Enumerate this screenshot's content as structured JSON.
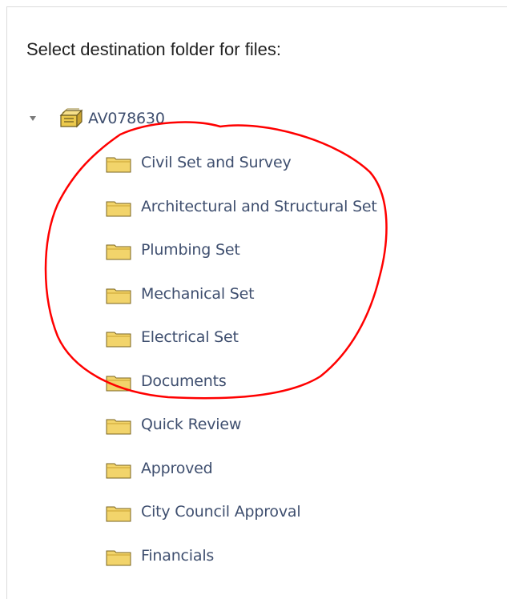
{
  "dialog": {
    "heading": "Select destination folder for files:"
  },
  "tree": {
    "root": {
      "label": "AV078630",
      "icon": "drawer-folder-icon",
      "expanded": true
    },
    "children": [
      {
        "label": "Civil Set and Survey",
        "icon": "folder-icon"
      },
      {
        "label": "Architectural and Structural Set",
        "icon": "folder-icon"
      },
      {
        "label": "Plumbing Set",
        "icon": "folder-icon"
      },
      {
        "label": "Mechanical Set",
        "icon": "folder-icon"
      },
      {
        "label": "Electrical Set",
        "icon": "folder-icon"
      },
      {
        "label": "Documents",
        "icon": "folder-icon"
      },
      {
        "label": "Quick Review",
        "icon": "folder-icon"
      },
      {
        "label": "Approved",
        "icon": "folder-icon"
      },
      {
        "label": "City Council Approval",
        "icon": "folder-icon"
      },
      {
        "label": "Financials",
        "icon": "folder-icon"
      }
    ]
  },
  "colors": {
    "label_text": "#3f4f6f",
    "folder_fill": "#f2d46b",
    "annotation_stroke": "#ff0000"
  }
}
